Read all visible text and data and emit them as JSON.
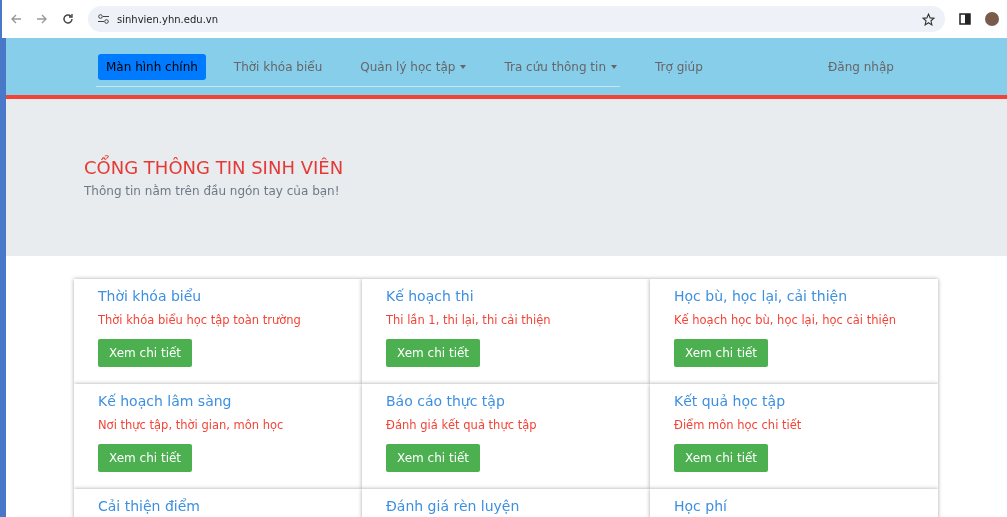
{
  "browser": {
    "url": "sinhvien.yhn.edu.vn"
  },
  "nav": {
    "items": [
      {
        "label": "Màn hình chính",
        "selected": true,
        "kind": "link"
      },
      {
        "label": "Thời khóa biểu",
        "selected": false,
        "kind": "link"
      },
      {
        "label": "Quản lý học tập",
        "selected": false,
        "kind": "dropdown"
      },
      {
        "label": "Tra cứu thông tin",
        "selected": false,
        "kind": "dropdown"
      },
      {
        "label": "Trợ giúp",
        "selected": false,
        "kind": "link"
      }
    ],
    "login": "Đăng nhập"
  },
  "hero": {
    "title": "CỔNG THÔNG TIN SINH VIÊN",
    "subtitle": "Thông tin nằm trên đầu ngón tay của bạn!"
  },
  "cards": [
    {
      "title": "Thời khóa biểu",
      "description": "Thời khóa biểu học tập toàn trường",
      "button": "Xem chi tiết"
    },
    {
      "title": "Kế hoạch thi",
      "description": "Thi lần 1, thi lại, thi cải thiện",
      "button": "Xem chi tiết"
    },
    {
      "title": "Học bù, học lại, cải thiện",
      "description": "Kế hoạch học bù, học lại, học cải thiện",
      "button": "Xem chi tiết"
    },
    {
      "title": "Kế hoạch lâm sàng",
      "description": "Nơi thực tập, thời gian, môn học",
      "button": "Xem chi tiết"
    },
    {
      "title": "Báo cáo thực tập",
      "description": "Đánh giá kết quả thực tập",
      "button": "Xem chi tiết"
    },
    {
      "title": "Kết quả học tập",
      "description": "Điểm môn học chi tiết",
      "button": "Xem chi tiết"
    },
    {
      "title": "Cải thiện điểm"
    },
    {
      "title": "Đánh giá rèn luyện"
    },
    {
      "title": "Học phí"
    }
  ]
}
